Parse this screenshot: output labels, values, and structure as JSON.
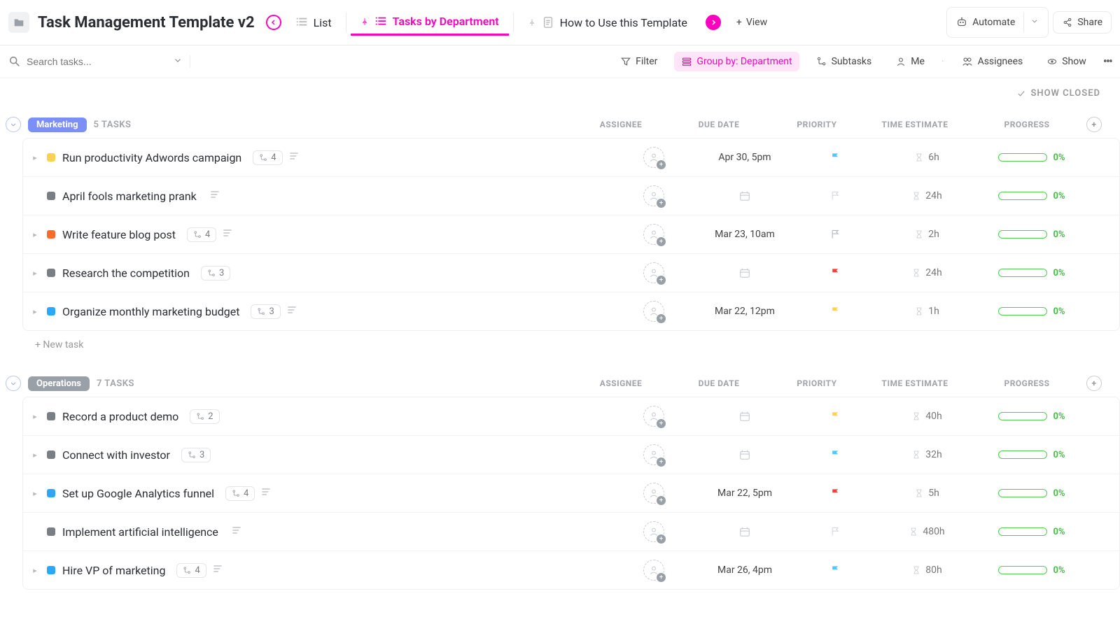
{
  "header": {
    "title": "Task Management Template v2",
    "view_tabs": {
      "list": "List",
      "tasks_by_dept": "Tasks by Department",
      "howto": "How to Use this Template"
    },
    "add_view": "View",
    "automate": "Automate",
    "share": "Share"
  },
  "toolbar": {
    "search_placeholder": "Search tasks...",
    "filter": "Filter",
    "group_by": "Group by: Department",
    "subtasks": "Subtasks",
    "me": "Me",
    "assignees": "Assignees",
    "show": "Show"
  },
  "show_closed": "SHOW CLOSED",
  "columns": {
    "assignee": "ASSIGNEE",
    "due": "DUE DATE",
    "priority": "PRIORITY",
    "time": "TIME ESTIMATE",
    "progress": "PROGRESS"
  },
  "new_task": "+ New task",
  "groups": [
    {
      "name": "Marketing",
      "color": "#7b8ff7",
      "count_label": "5 TASKS",
      "tasks": [
        {
          "expand": true,
          "status": "c-yellow",
          "title": "Run productivity Adwords campaign",
          "sub": "4",
          "desc": true,
          "due": "Apr 30, 5pm",
          "flag": "#4cc7ff",
          "time": "6h",
          "prog": "0%"
        },
        {
          "expand": false,
          "status": "c-dgrey",
          "title": "April fools marketing prank",
          "sub": null,
          "desc": true,
          "due": null,
          "flag": "#d6d8db",
          "time": "24h",
          "prog": "0%"
        },
        {
          "expand": true,
          "status": "c-orange",
          "title": "Write feature blog post",
          "sub": "4",
          "desc": true,
          "due": "Mar 23, 10am",
          "flag": "#b5b9bf",
          "time": "2h",
          "prog": "0%"
        },
        {
          "expand": true,
          "status": "c-dgrey",
          "title": "Research the competition",
          "sub": "3",
          "desc": false,
          "due": null,
          "flag": "#ff3b3b",
          "time": "24h",
          "prog": "0%"
        },
        {
          "expand": true,
          "status": "c-blue",
          "title": "Organize monthly marketing budget",
          "sub": "3",
          "desc": true,
          "due": "Mar 22, 12pm",
          "flag": "#ffd24d",
          "time": "1h",
          "prog": "0%"
        }
      ]
    },
    {
      "name": "Operations",
      "color": "#9aa0a8",
      "count_label": "7 TASKS",
      "tasks": [
        {
          "expand": true,
          "status": "c-dgrey",
          "title": "Record a product demo",
          "sub": "2",
          "desc": false,
          "due": null,
          "flag": "#ffd24d",
          "time": "40h",
          "prog": "0%"
        },
        {
          "expand": true,
          "status": "c-dgrey",
          "title": "Connect with investor",
          "sub": "3",
          "desc": false,
          "due": null,
          "flag": "#4cc7ff",
          "time": "32h",
          "prog": "0%"
        },
        {
          "expand": true,
          "status": "c-blue",
          "title": "Set up Google Analytics funnel",
          "sub": "4",
          "desc": true,
          "due": "Mar 22, 5pm",
          "flag": "#ff3b3b",
          "time": "5h",
          "prog": "0%"
        },
        {
          "expand": false,
          "status": "c-dgrey",
          "title": "Implement artificial intelligence",
          "sub": null,
          "desc": true,
          "due": null,
          "flag": "#d6d8db",
          "time": "480h",
          "prog": "0%"
        },
        {
          "expand": true,
          "status": "c-blue",
          "title": "Hire VP of marketing",
          "sub": "4",
          "desc": true,
          "due": "Mar 26, 4pm",
          "flag": "#4cc7ff",
          "time": "80h",
          "prog": "0%"
        }
      ]
    }
  ]
}
